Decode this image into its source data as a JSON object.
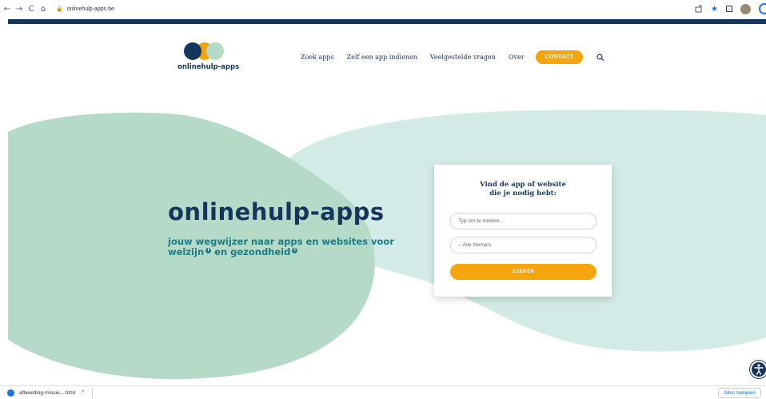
{
  "browser": {
    "back_icon": "←",
    "forward_icon": "→",
    "reload_icon": "C",
    "home_icon": "⌂",
    "lock_icon": "🔒",
    "url": "onlinehulp-apps.be",
    "star_icon": "★"
  },
  "site": {
    "logo_text": "onlinehulp-apps",
    "nav": {
      "zoek_apps": "Zoek apps",
      "indienen": "Zelf een app indienen",
      "faq": "Veelgestelde vragen",
      "over": "Over",
      "contact": "CONTACT"
    },
    "colors": {
      "navy": "#14365c",
      "orange": "#f5a40c",
      "mint": "#b5dac8",
      "mint_light": "#d3ebe6",
      "teal": "#1d7c87"
    }
  },
  "hero": {
    "title": "onlinehulp-apps",
    "subtitle_line1": "jouw wegwijzer naar apps en websites voor",
    "subtitle_line2_a": "welzijn",
    "subtitle_line2_b": " en gezondheid",
    "info_marker": "i"
  },
  "search_card": {
    "title_line1": "Vind de app of website",
    "title_line2": "die je nodig hebt:",
    "search_placeholder": "Typ om te zoeken...",
    "theme_select": "-- Alle thema's",
    "submit_label": "ZOEKEN"
  },
  "downloads": {
    "file_name": "afbeelding-missie....html",
    "chevron": "^",
    "show_all": "Alles bekijken"
  }
}
